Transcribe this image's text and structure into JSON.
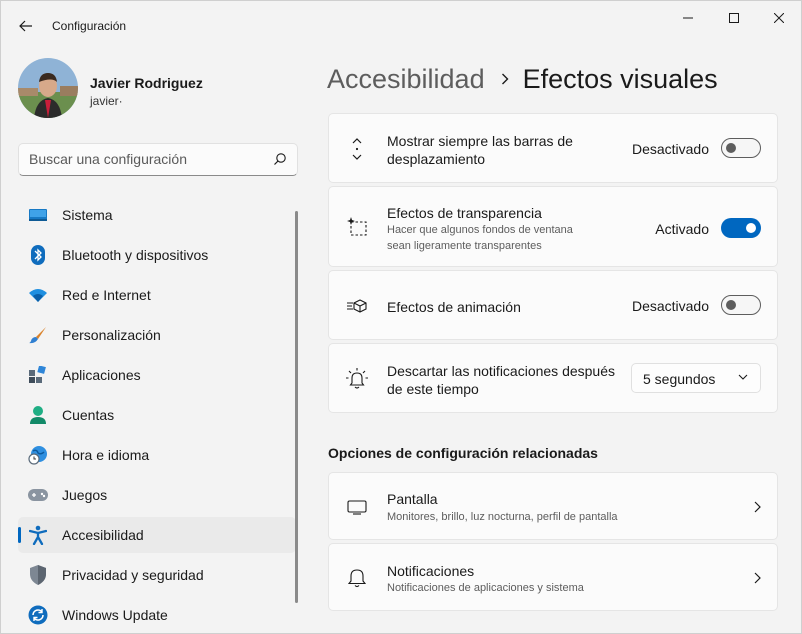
{
  "window": {
    "app_title": "Configuración"
  },
  "profile": {
    "name": "Javier Rodriguez",
    "email": "javier·"
  },
  "search": {
    "placeholder": "Buscar una configuración"
  },
  "sidebar": {
    "items": [
      {
        "label": "Sistema",
        "icon": "system-display-icon"
      },
      {
        "label": "Bluetooth y dispositivos",
        "icon": "bluetooth-icon"
      },
      {
        "label": "Red e Internet",
        "icon": "wifi-icon"
      },
      {
        "label": "Personalización",
        "icon": "paintbrush-icon"
      },
      {
        "label": "Aplicaciones",
        "icon": "apps-icon"
      },
      {
        "label": "Cuentas",
        "icon": "account-icon"
      },
      {
        "label": "Hora e idioma",
        "icon": "globe-clock-icon"
      },
      {
        "label": "Juegos",
        "icon": "gamepad-icon"
      },
      {
        "label": "Accesibilidad",
        "icon": "accessibility-icon",
        "active": true
      },
      {
        "label": "Privacidad y seguridad",
        "icon": "shield-icon"
      },
      {
        "label": "Windows Update",
        "icon": "update-icon"
      }
    ]
  },
  "breadcrumb": {
    "parent": "Accesibilidad",
    "current": "Efectos visuales"
  },
  "settings": {
    "scrollbars": {
      "title_line1": "Mostrar siempre las barras de",
      "title_line2": "desplazamiento",
      "state_label": "Desactivado",
      "on": false
    },
    "transparency": {
      "title": "Efectos de transparencia",
      "desc_line1": "Hacer que algunos fondos de ventana",
      "desc_line2": "sean ligeramente transparentes",
      "state_label": "Activado",
      "on": true
    },
    "animation": {
      "title": "Efectos de animación",
      "state_label": "Desactivado",
      "on": false
    },
    "notifications_dismiss": {
      "title_line1": "Descartar las notificaciones después",
      "title_line2": "de este tiempo",
      "selected": "5 segundos"
    }
  },
  "related": {
    "heading": "Opciones de configuración relacionadas",
    "items": [
      {
        "title": "Pantalla",
        "desc": "Monitores, brillo, luz nocturna, perfil de pantalla",
        "icon": "monitor-icon"
      },
      {
        "title": "Notificaciones",
        "desc": "Notificaciones de aplicaciones y sistema",
        "icon": "bell-icon"
      }
    ]
  },
  "colors": {
    "accent": "#0067c0",
    "background": "#f3f3f3",
    "card": "#fbfbfb"
  }
}
